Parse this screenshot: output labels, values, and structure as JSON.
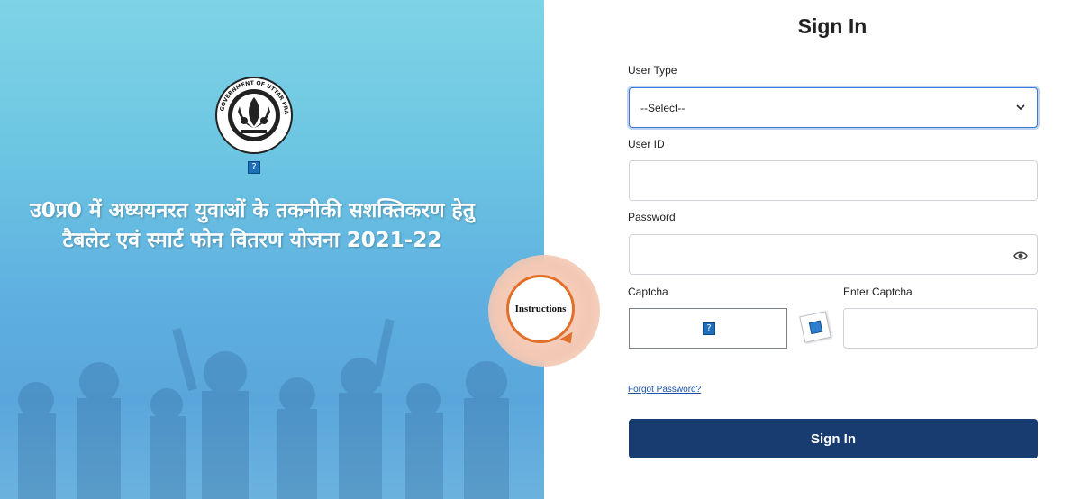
{
  "hero": {
    "title_line1": "उ0प्र0 में अध्ययनरत युवाओं के तकनीकी सशक्तिकरण हेतु",
    "title_line2": "टैबलेट एवं स्मार्ट फोन वितरण योजना 2021-22",
    "emblem_text": "GOVERNMENT OF UTTAR PRADESH",
    "broken_image_glyph": "?"
  },
  "instructions": {
    "label": "Instructions"
  },
  "signin": {
    "title": "Sign In",
    "user_type_label": "User Type",
    "user_type_value": "--Select--",
    "user_id_label": "User ID",
    "password_label": "Password",
    "captcha_label": "Captcha",
    "captcha_image_glyph": "?",
    "enter_captcha_label": "Enter Captcha",
    "forgot_password": "Forgot Password?",
    "button_label": "Sign In"
  },
  "colors": {
    "primary_button": "#183c70",
    "link": "#1a4fa8",
    "accent_orange": "#e2702b"
  }
}
